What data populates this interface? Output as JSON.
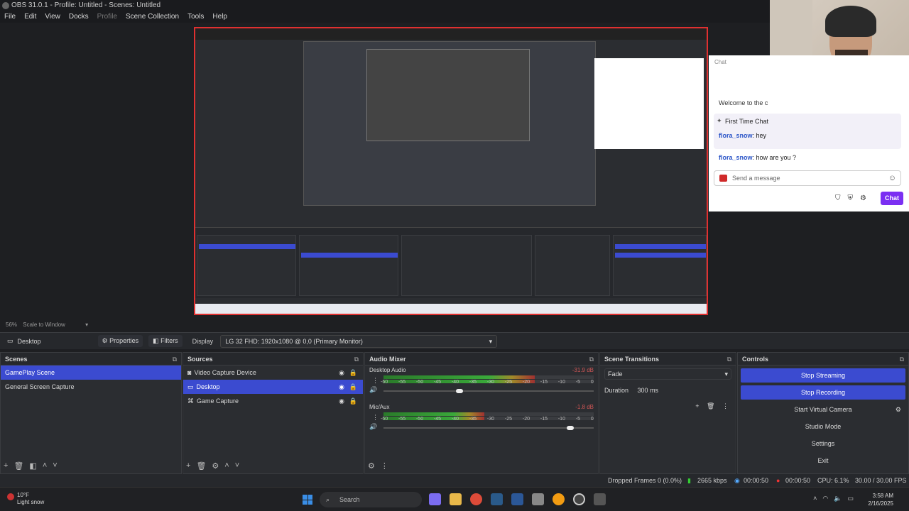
{
  "window": {
    "title": "OBS 31.0.1 - Profile: Untitled - Scenes: Untitled"
  },
  "menu": [
    "File",
    "Edit",
    "View",
    "Docks",
    "Profile",
    "Scene Collection",
    "Tools",
    "Help"
  ],
  "preview": {
    "chat": {
      "title": "Chat",
      "welcome": "Welcome to the c",
      "first_time_chat": "First Time Chat",
      "msg1_user": "flora_snow",
      "msg1_text": ": hey",
      "msg2_user": "flora_snow",
      "msg2_text": ": how are you ?",
      "input_placeholder": "Send a message",
      "chat_button": "Chat"
    },
    "scale": "56%",
    "scale_mode": "Scale to Window"
  },
  "source_bar": {
    "source_name": "Desktop",
    "properties": "Properties",
    "filters": "Filters",
    "display_label": "Display",
    "display_value": "LG 32 FHD: 1920x1080 @ 0,0 (Primary Monitor)"
  },
  "scenes": {
    "title": "Scenes",
    "items": [
      "GamePlay Scene",
      "General Screen Capture"
    ]
  },
  "sources": {
    "title": "Sources",
    "items": [
      "Video Capture Device",
      "Desktop",
      "Game Capture"
    ]
  },
  "audio_mixer": {
    "title": "Audio Mixer",
    "ticks": [
      "-60",
      "-55",
      "-50",
      "-45",
      "-40",
      "-35",
      "-30",
      "-25",
      "-20",
      "-15",
      "-10",
      "-5",
      "0"
    ],
    "channels": [
      {
        "name": "Desktop Audio",
        "db": "-31.9 dB",
        "level": 0.72,
        "volume": 0.36
      },
      {
        "name": "Mic/Aux",
        "db": "-1.8 dB",
        "level": 0.48,
        "volume": 0.89
      }
    ]
  },
  "scene_transitions": {
    "title": "Scene Transitions",
    "transition": "Fade",
    "duration_label": "Duration",
    "duration_value": "300 ms"
  },
  "controls": {
    "title": "Controls",
    "stop_streaming": "Stop Streaming",
    "stop_recording": "Stop Recording",
    "start_virtual_camera": "Start Virtual Camera",
    "studio_mode": "Studio Mode",
    "settings": "Settings",
    "exit": "Exit"
  },
  "status": {
    "dropped": "Dropped Frames 0 (0.0%)",
    "bitrate": "2665 kbps",
    "stream_time": "00:00:50",
    "rec_time": "00:00:50",
    "cpu": "CPU: 6.1%",
    "fps": "30.00 / 30.00 FPS"
  },
  "taskbar": {
    "temp": "10°F",
    "weather": "Light snow",
    "search": "Search",
    "time": "3:58 AM",
    "date": "2/16/2025"
  },
  "colors": {
    "accent": "#3b4bd0",
    "preview_border": "#e03030",
    "twitch_purple": "#7b2ff2"
  }
}
